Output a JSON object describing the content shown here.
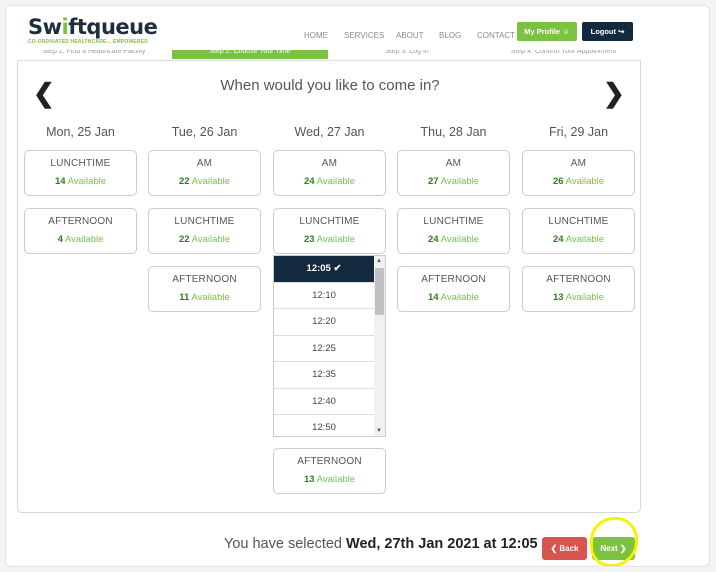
{
  "brand": {
    "name_pre": "Sw",
    "name_accent": "i",
    "name_post": "ftqueue",
    "tagline": "CO-ORDINATED HEALTHCARE... EMPOWERED"
  },
  "nav": {
    "links": [
      "HOME",
      "SERVICES",
      "ABOUT",
      "BLOG",
      "CONTACT"
    ],
    "profile_label": "My Profile ☺",
    "logout_label": "Logout ↪"
  },
  "steps": [
    {
      "label": "Step 1: Find a Healthcare Facility",
      "active": false
    },
    {
      "label": "Step 2: Choose Your Time",
      "active": true
    },
    {
      "label": "Step 3: Log In",
      "active": false
    },
    {
      "label": "Step 4: Confirm Your Appointment",
      "active": false
    }
  ],
  "scheduler": {
    "question": "When would you like to come in?",
    "prev_icon": "❮",
    "next_icon": "❯",
    "days": [
      {
        "label": "Mon, 25 Jan",
        "slots": [
          {
            "name": "LUNCHTIME",
            "count": "14",
            "available": "Available"
          },
          {
            "name": "AFTERNOON",
            "count": "4",
            "available": "Available"
          }
        ]
      },
      {
        "label": "Tue, 26 Jan",
        "slots": [
          {
            "name": "AM",
            "count": "22",
            "available": "Available"
          },
          {
            "name": "LUNCHTIME",
            "count": "22",
            "available": "Available"
          },
          {
            "name": "AFTERNOON",
            "count": "11",
            "available": "Available"
          }
        ]
      },
      {
        "label": "Wed, 27 Jan",
        "slots": [
          {
            "name": "AM",
            "count": "24",
            "available": "Available"
          },
          {
            "name": "LUNCHTIME",
            "count": "23",
            "available": "Available"
          },
          {
            "name": "AFTERNOON",
            "count": "13",
            "available": "Available"
          }
        ]
      },
      {
        "label": "Thu, 28 Jan",
        "slots": [
          {
            "name": "AM",
            "count": "27",
            "available": "Available"
          },
          {
            "name": "LUNCHTIME",
            "count": "24",
            "available": "Available"
          },
          {
            "name": "AFTERNOON",
            "count": "14",
            "available": "Available"
          }
        ]
      },
      {
        "label": "Fri, 29 Jan",
        "slots": [
          {
            "name": "AM",
            "count": "26",
            "available": "Available"
          },
          {
            "name": "LUNCHTIME",
            "count": "24",
            "available": "Available"
          },
          {
            "name": "AFTERNOON",
            "count": "13",
            "available": "Available"
          }
        ]
      }
    ],
    "times": [
      {
        "label": "12:05 ✔",
        "selected": true
      },
      {
        "label": "12:10",
        "selected": false
      },
      {
        "label": "12:20",
        "selected": false
      },
      {
        "label": "12:25",
        "selected": false
      },
      {
        "label": "12:35",
        "selected": false
      },
      {
        "label": "12:40",
        "selected": false
      },
      {
        "label": "12:50",
        "selected": false
      }
    ],
    "scroll_up": "▲",
    "scroll_down": "▼"
  },
  "footer": {
    "selected_prefix": "You have selected",
    "selected_value": "Wed, 27th Jan 2021 at 12:05",
    "back_label": "❮ Back",
    "next_label": "Next ❯"
  },
  "colors": {
    "brand_green": "#7cc242",
    "navy": "#13293d",
    "back_red": "#d9534f",
    "highlight": "#f4f400"
  }
}
